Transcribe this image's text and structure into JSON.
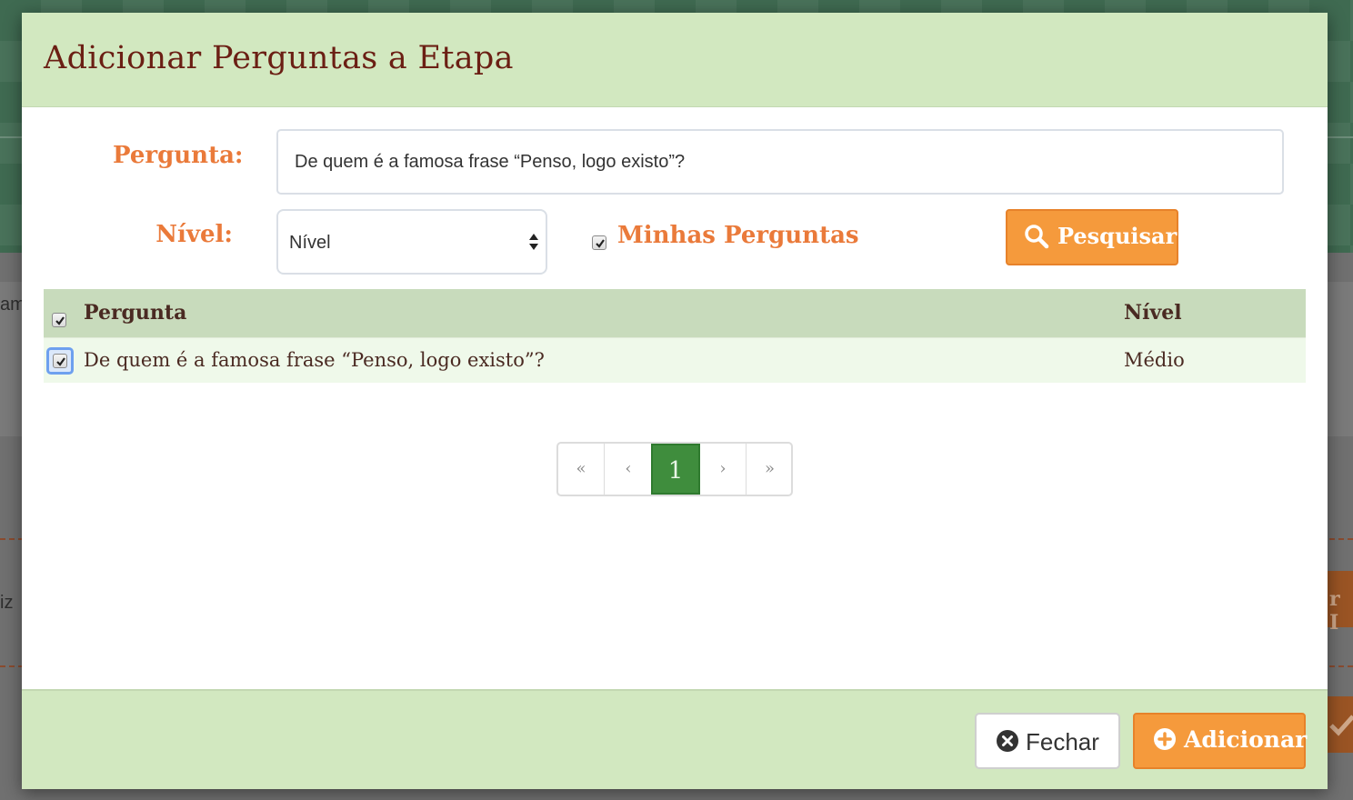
{
  "background": {
    "left_text_1": "am",
    "left_text_2": "iz",
    "right_button_partial": "r I"
  },
  "modal": {
    "title": "Adicionar Perguntas a Etapa",
    "form": {
      "pergunta_label": "Pergunta:",
      "pergunta_value": "De quem é a famosa frase “Penso, logo existo”?",
      "nivel_label": "Nível:",
      "nivel_selected": "Nível",
      "minhas_perguntas_label": "Minhas Perguntas",
      "minhas_perguntas_checked": true,
      "search_button": "Pesquisar"
    },
    "table": {
      "headers": [
        "Pergunta",
        "Nível"
      ],
      "rows": [
        {
          "pergunta": "De quem é a famosa frase “Penso, logo existo”?",
          "nivel": "Médio",
          "checked": true
        }
      ]
    },
    "pagination": {
      "first": "«",
      "prev": "‹",
      "current": "1",
      "next": "›",
      "last": "»"
    },
    "footer": {
      "close_button": "Fechar",
      "add_button": "Adicionar"
    }
  },
  "colors": {
    "header_bg": "#d2e8c0",
    "title": "#6b1f14",
    "label_accent": "#ea7a3a",
    "button_orange": "#f59a3c",
    "pager_active": "#3f8d3d"
  }
}
